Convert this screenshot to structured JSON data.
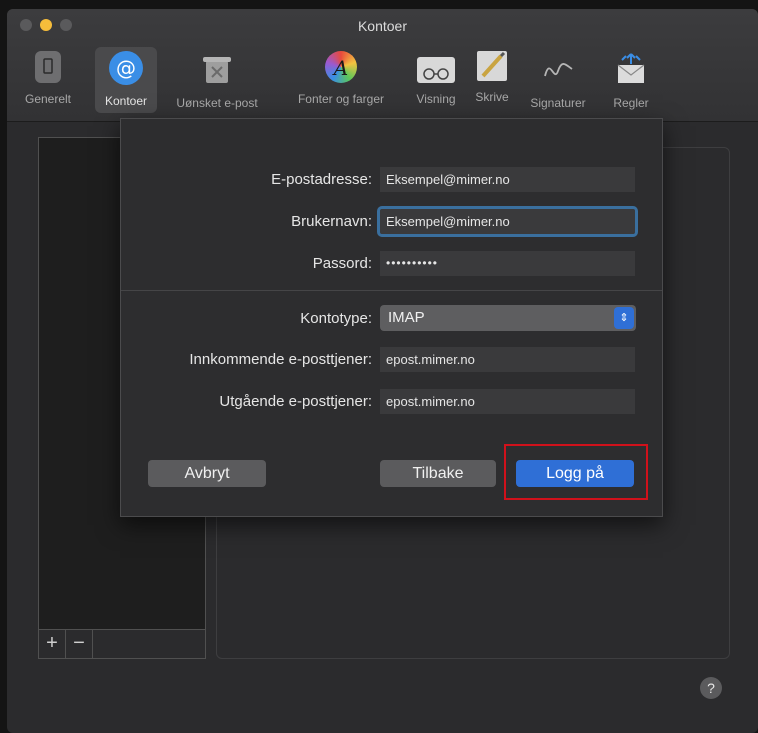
{
  "window": {
    "title": "Kontoer"
  },
  "toolbar": {
    "items": [
      {
        "label": "Generelt",
        "icon": "switch-icon"
      },
      {
        "label": "Kontoer",
        "icon": "at-sign-icon"
      },
      {
        "label": "Uønsket e-post",
        "icon": "trash-icon"
      },
      {
        "label": "Fonter og farger",
        "icon": "color-font-icon"
      },
      {
        "label": "Visning",
        "icon": "glasses-icon"
      },
      {
        "label": "Skrive",
        "icon": "pencil-icon"
      },
      {
        "label": "Signaturer",
        "icon": "signature-icon"
      },
      {
        "label": "Regler",
        "icon": "envelope-rules-icon"
      }
    ]
  },
  "form": {
    "email_label": "E-postadresse:",
    "email_value": "Eksempel@mimer.no",
    "username_label": "Brukernavn:",
    "username_value": "Eksempel@mimer.no",
    "password_label": "Passord:",
    "password_value": "••••••••••",
    "account_type_label": "Kontotype:",
    "account_type_value": "IMAP",
    "incoming_label": "Innkommende e-posttjener:",
    "incoming_value": "epost.mimer.no",
    "outgoing_label": "Utgående e-posttjener:",
    "outgoing_value": "epost.mimer.no"
  },
  "buttons": {
    "cancel": "Avbryt",
    "back": "Tilbake",
    "login": "Logg på"
  },
  "accounts_list": {
    "add": "+",
    "remove": "−"
  },
  "help": "?",
  "colors": {
    "accent": "#2f6fd6",
    "highlight": "#d0111b"
  }
}
